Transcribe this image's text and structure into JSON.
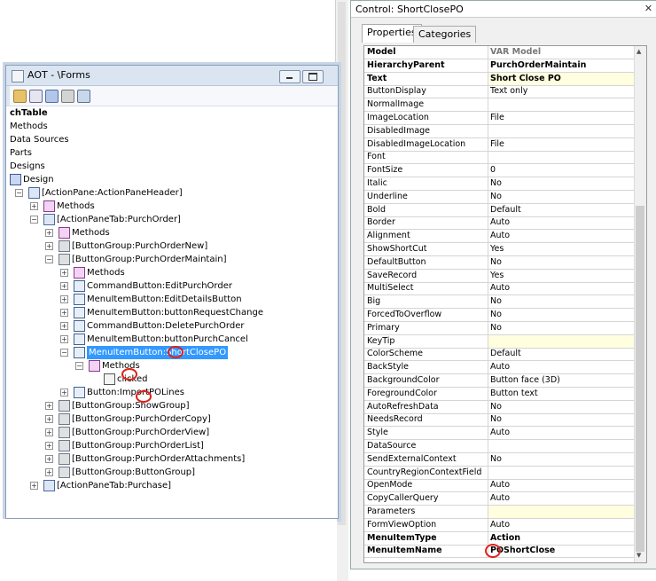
{
  "aot": {
    "title": "AOT - \\Forms",
    "tree": [
      {
        "label": "chTable",
        "indent": 0,
        "bold": true,
        "expander": "",
        "icon": "none"
      },
      {
        "label": "Methods",
        "indent": 0,
        "expander": "",
        "icon": "none"
      },
      {
        "label": "Data Sources",
        "indent": 0,
        "expander": "",
        "icon": "none"
      },
      {
        "label": "Parts",
        "indent": 0,
        "expander": "",
        "icon": "none"
      },
      {
        "label": "Designs",
        "indent": 0,
        "expander": "",
        "icon": "none"
      },
      {
        "label": "Design",
        "indent": 0,
        "expander": "",
        "icon": "design"
      },
      {
        "label": "[ActionPane:ActionPaneHeader]",
        "indent": 1,
        "expander": "minus",
        "icon": "pane"
      },
      {
        "label": "Methods",
        "indent": 2,
        "expander": "plus",
        "icon": "methods"
      },
      {
        "label": "[ActionPaneTab:PurchOrder]",
        "indent": 2,
        "expander": "minus",
        "icon": "pane"
      },
      {
        "label": "Methods",
        "indent": 3,
        "expander": "plus",
        "icon": "methods"
      },
      {
        "label": "[ButtonGroup:PurchOrderNew]",
        "indent": 3,
        "expander": "plus",
        "icon": "group"
      },
      {
        "label": "[ButtonGroup:PurchOrderMaintain]",
        "indent": 3,
        "expander": "minus",
        "icon": "group"
      },
      {
        "label": "Methods",
        "indent": 4,
        "expander": "plus",
        "icon": "methods"
      },
      {
        "label": "CommandButton:EditPurchOrder",
        "indent": 4,
        "expander": "plus",
        "icon": "button"
      },
      {
        "label": "MenuItemButton:EditDetailsButton",
        "indent": 4,
        "expander": "plus",
        "icon": "button"
      },
      {
        "label": "MenuItemButton:buttonRequestChange",
        "indent": 4,
        "expander": "plus",
        "icon": "button"
      },
      {
        "label": "CommandButton:DeletePurchOrder",
        "indent": 4,
        "expander": "plus",
        "icon": "button"
      },
      {
        "label": "MenuItemButton:buttonPurchCancel",
        "indent": 4,
        "expander": "plus",
        "icon": "button"
      },
      {
        "label": "MenuItemButton:ShortClosePO",
        "indent": 4,
        "expander": "minus",
        "icon": "button",
        "selected": true
      },
      {
        "label": "Methods",
        "indent": 5,
        "expander": "minus",
        "icon": "methods"
      },
      {
        "label": "clicked",
        "indent": 6,
        "expander": "",
        "icon": "method"
      },
      {
        "label": "Button:ImportPOLines",
        "indent": 4,
        "expander": "plus",
        "icon": "button"
      },
      {
        "label": "[ButtonGroup:ShowGroup]",
        "indent": 3,
        "expander": "plus",
        "icon": "group"
      },
      {
        "label": "[ButtonGroup:PurchOrderCopy]",
        "indent": 3,
        "expander": "plus",
        "icon": "group"
      },
      {
        "label": "[ButtonGroup:PurchOrderView]",
        "indent": 3,
        "expander": "plus",
        "icon": "group"
      },
      {
        "label": "[ButtonGroup:PurchOrderList]",
        "indent": 3,
        "expander": "plus",
        "icon": "group"
      },
      {
        "label": "[ButtonGroup:PurchOrderAttachments]",
        "indent": 3,
        "expander": "plus",
        "icon": "group"
      },
      {
        "label": "[ButtonGroup:ButtonGroup]",
        "indent": 3,
        "expander": "plus",
        "icon": "group"
      },
      {
        "label": "[ActionPaneTab:Purchase]",
        "indent": 2,
        "expander": "plus",
        "icon": "pane"
      }
    ]
  },
  "props": {
    "title": "Control: ShortClosePO",
    "tabs": [
      "Properties",
      "Categories"
    ],
    "rows": [
      {
        "name": "Model",
        "value": "VAR Model",
        "bold": true,
        "gray": true
      },
      {
        "name": "HierarchyParent",
        "value": "PurchOrderMaintain",
        "bold": true
      },
      {
        "name": "Text",
        "value": "Short Close PO",
        "bold": true,
        "yellow": true
      },
      {
        "name": "ButtonDisplay",
        "value": "Text only"
      },
      {
        "name": "NormalImage",
        "value": ""
      },
      {
        "name": "ImageLocation",
        "value": "File"
      },
      {
        "name": "DisabledImage",
        "value": ""
      },
      {
        "name": "DisabledImageLocation",
        "value": "File"
      },
      {
        "name": "Font",
        "value": ""
      },
      {
        "name": "FontSize",
        "value": "0"
      },
      {
        "name": "Italic",
        "value": "No"
      },
      {
        "name": "Underline",
        "value": "No"
      },
      {
        "name": "Bold",
        "value": "Default"
      },
      {
        "name": "Border",
        "value": "Auto"
      },
      {
        "name": "Alignment",
        "value": "Auto"
      },
      {
        "name": "ShowShortCut",
        "value": "Yes"
      },
      {
        "name": "DefaultButton",
        "value": "No"
      },
      {
        "name": "SaveRecord",
        "value": "Yes"
      },
      {
        "name": "MultiSelect",
        "value": "Auto"
      },
      {
        "name": "Big",
        "value": "No"
      },
      {
        "name": "ForcedToOverflow",
        "value": "No"
      },
      {
        "name": "Primary",
        "value": "No"
      },
      {
        "name": "KeyTip",
        "value": "",
        "yellow": true
      },
      {
        "name": "ColorScheme",
        "value": "Default"
      },
      {
        "name": "BackStyle",
        "value": "Auto"
      },
      {
        "name": "BackgroundColor",
        "value": "Button face (3D)"
      },
      {
        "name": "ForegroundColor",
        "value": "Button text"
      },
      {
        "name": "AutoRefreshData",
        "value": "No"
      },
      {
        "name": "NeedsRecord",
        "value": "No"
      },
      {
        "name": "Style",
        "value": "Auto"
      },
      {
        "name": "DataSource",
        "value": ""
      },
      {
        "name": "SendExternalContext",
        "value": "No"
      },
      {
        "name": "CountryRegionContextField",
        "value": ""
      },
      {
        "name": "OpenMode",
        "value": "Auto"
      },
      {
        "name": "CopyCallerQuery",
        "value": "Auto"
      },
      {
        "name": "Parameters",
        "value": "",
        "yellow": true
      },
      {
        "name": "FormViewOption",
        "value": "Auto"
      },
      {
        "name": "MenuItemType",
        "value": "Action",
        "bold": true
      },
      {
        "name": "MenuItemName",
        "value": "POShortClose",
        "bold": true
      }
    ]
  }
}
